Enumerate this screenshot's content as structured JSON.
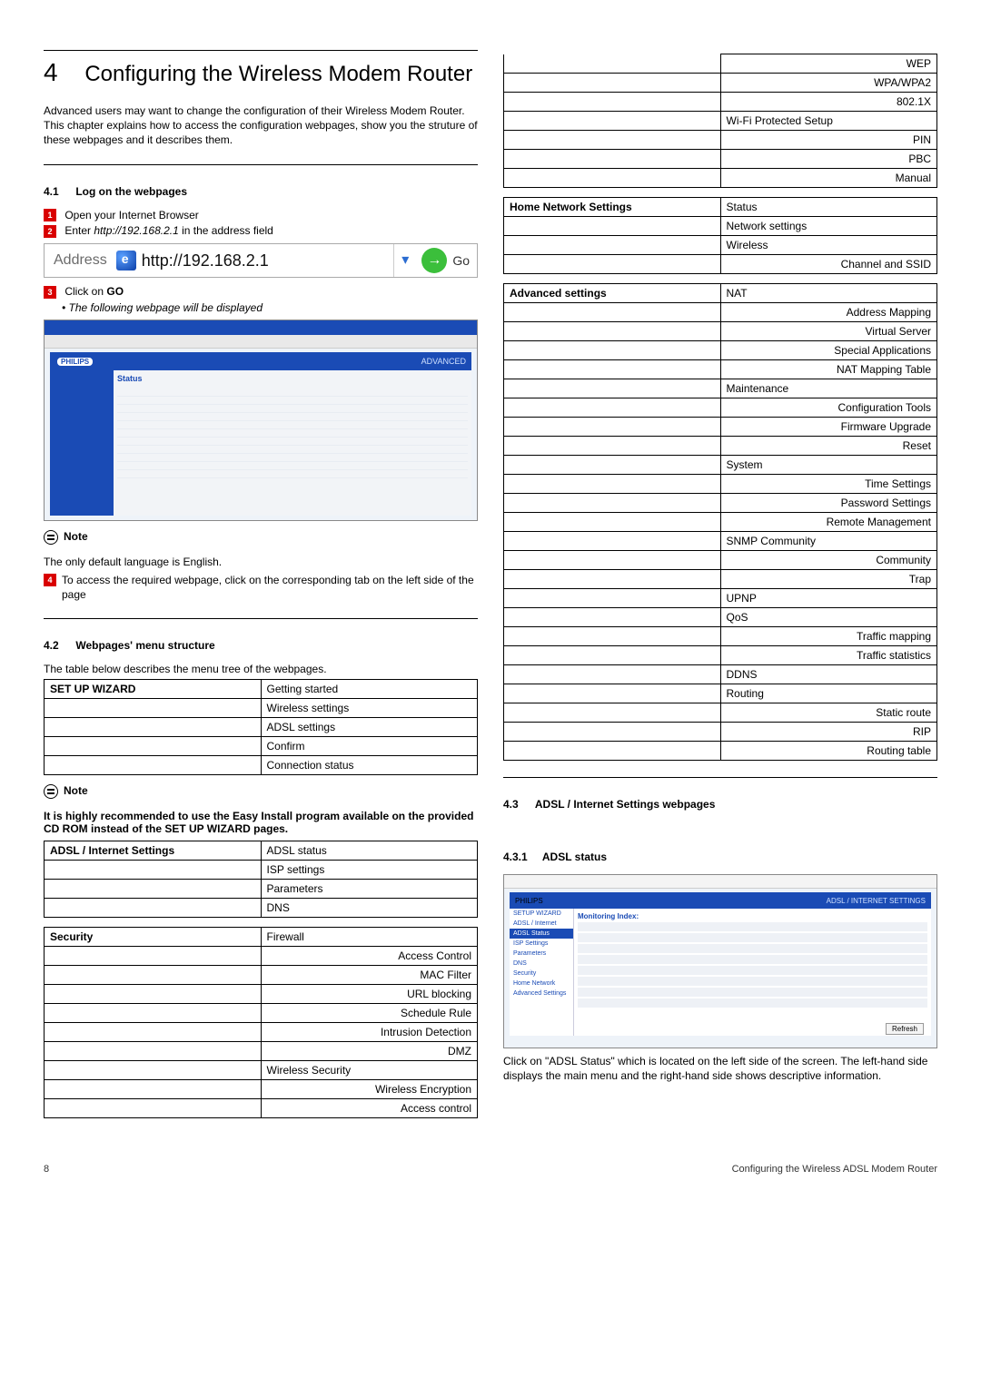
{
  "chapter": {
    "num": "4",
    "title": "Configuring the Wireless Modem Router"
  },
  "intro": "Advanced users may want to change the configuration of their Wireless Modem Router. This chapter explains how to access the configuration webpages, show you the struture of these webpages and it describes them.",
  "s41": {
    "heading_num": "4.1",
    "heading": "Log on the webpages",
    "step1": "Open your Internet Browser",
    "step2_pre": "Enter ",
    "step2_url": "http://192.168.2.1",
    "step2_post": " in the address field",
    "addr_label": "Address",
    "addr_url": "http://192.168.2.1",
    "go": "Go",
    "step3_pre": "Click on ",
    "step3_go": "GO",
    "step3_bullet": "The following webpage will be displayed"
  },
  "note1": {
    "label": "Note",
    "text": "The only default language is English."
  },
  "step4": "To access the required webpage, click on the corresponding tab on the left side of the page",
  "s42": {
    "heading_num": "4.2",
    "heading": "Webpages' menu structure",
    "desc": "The table below describes the menu tree of the webpages."
  },
  "note2": {
    "label": "Note",
    "text": "It is highly recommended to use the Easy Install program available on the provided CD ROM instead of the SET UP WIZARD pages."
  },
  "tbl_setup": {
    "head": "SET UP WIZARD",
    "r0": "Getting started",
    "r1": "Wireless settings",
    "r2": "ADSL settings",
    "r3": "Confirm",
    "r4": "Connection status"
  },
  "tbl_adsl": {
    "head": "ADSL / Internet Settings",
    "r0": "ADSL status",
    "r1": "ISP settings",
    "r2": "Parameters",
    "r3": "DNS"
  },
  "tbl_sec": {
    "head": "Security",
    "r0": "Firewall",
    "r1": "Access Control",
    "r2": "MAC Filter",
    "r3": "URL blocking",
    "r4": "Schedule Rule",
    "r5": "Intrusion Detection",
    "r6": "DMZ",
    "r7": "Wireless Security",
    "r8": "Wireless Encryption",
    "r9": "Access control"
  },
  "tbl_sec_tail": {
    "r0": "WEP",
    "r1": "WPA/WPA2",
    "r2": "802.1X",
    "r3": "Wi-Fi Protected Setup",
    "r4": "PIN",
    "r5": "PBC",
    "r6": "Manual"
  },
  "tbl_home": {
    "head": "Home Network Settings",
    "r0": "Status",
    "r1": "Network settings",
    "r2": "Wireless",
    "r3": "Channel and SSID"
  },
  "tbl_adv": {
    "head": "Advanced settings",
    "r0": "NAT",
    "r1": "Address Mapping",
    "r2": "Virtual Server",
    "r3": "Special Applications",
    "r4": "NAT Mapping Table",
    "r5": "Maintenance",
    "r6": "Configuration Tools",
    "r7": "Firmware Upgrade",
    "r8": "Reset",
    "r9": "System",
    "r10": "Time Settings",
    "r11": "Password Settings",
    "r12": "Remote Management",
    "r13": "SNMP Community",
    "r14": "Community",
    "r15": "Trap",
    "r16": "UPNP",
    "r17": "QoS",
    "r18": "Traffic mapping",
    "r19": "Traffic statistics",
    "r20": "DDNS",
    "r21": "Routing",
    "r22": "Static route",
    "r23": "RIP",
    "r24": "Routing table"
  },
  "s43": {
    "heading_num": "4.3",
    "heading": "ADSL / Internet Settings webpages"
  },
  "s431": {
    "heading_num": "4.3.1",
    "heading": "ADSL status"
  },
  "adsl_desc": "Click on \"ADSL Status\" which is located on the left side of the screen. The left-hand side displays the main menu and the right-hand side shows descriptive information.",
  "screenshot": {
    "philips": "PHILIPS",
    "advanced": "ADVANCED",
    "status": "Status",
    "adsl_hdr": "ADSL / INTERNET SETTINGS",
    "monitoring": "Monitoring Index:",
    "refresh": "Refresh"
  },
  "footer": {
    "page": "8",
    "title": "Configuring the Wireless ADSL Modem Router"
  }
}
